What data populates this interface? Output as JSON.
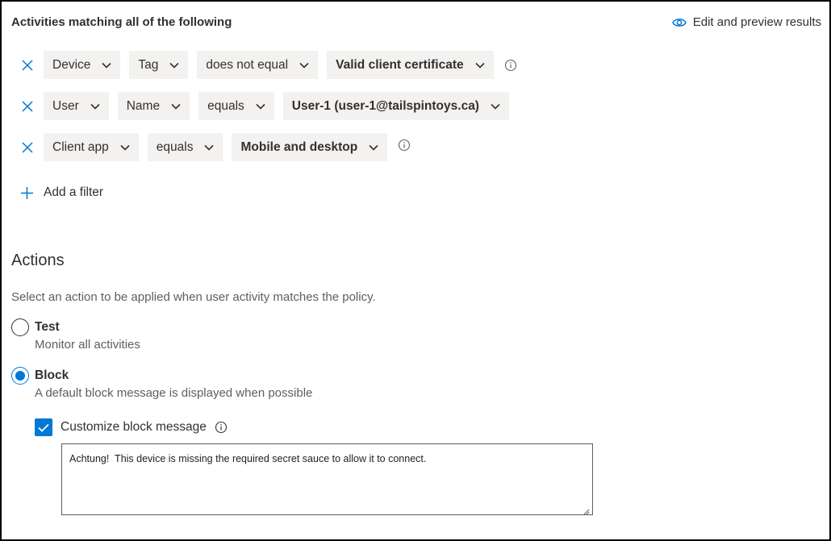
{
  "header": {
    "title": "Activities matching all of the following",
    "preview_link": "Edit and preview results"
  },
  "filters": [
    {
      "field": "Device",
      "subfield": "Tag",
      "operator": "does not equal",
      "value": "Valid client certificate",
      "has_info": true
    },
    {
      "field": "User",
      "subfield": "Name",
      "operator": "equals",
      "value": "User-1 (user-1@tailspintoys.ca)",
      "has_info": false
    },
    {
      "field": "Client app",
      "operator": "equals",
      "value": "Mobile and desktop",
      "has_info": true
    }
  ],
  "add_filter_label": "Add a filter",
  "actions": {
    "title": "Actions",
    "description": "Select an action to be applied when user activity matches the policy.",
    "options": [
      {
        "label": "Test",
        "description": "Monitor all activities",
        "selected": false
      },
      {
        "label": "Block",
        "description": "A default block message is displayed when possible",
        "selected": true
      }
    ],
    "customize": {
      "label": "Customize block message",
      "checked": true,
      "message": "Achtung!  This device is missing the required secret sauce to allow it to connect."
    }
  },
  "icons": {
    "remove": "close-icon",
    "dropdown": "chevron-down-icon",
    "info": "info-icon",
    "preview": "eye-icon",
    "add": "plus-icon",
    "check": "checkmark-icon"
  },
  "colors": {
    "accent": "#0078d4",
    "dropdown_bg": "#f3f2f1",
    "text": "#323130",
    "secondary_text": "#605e5c"
  }
}
